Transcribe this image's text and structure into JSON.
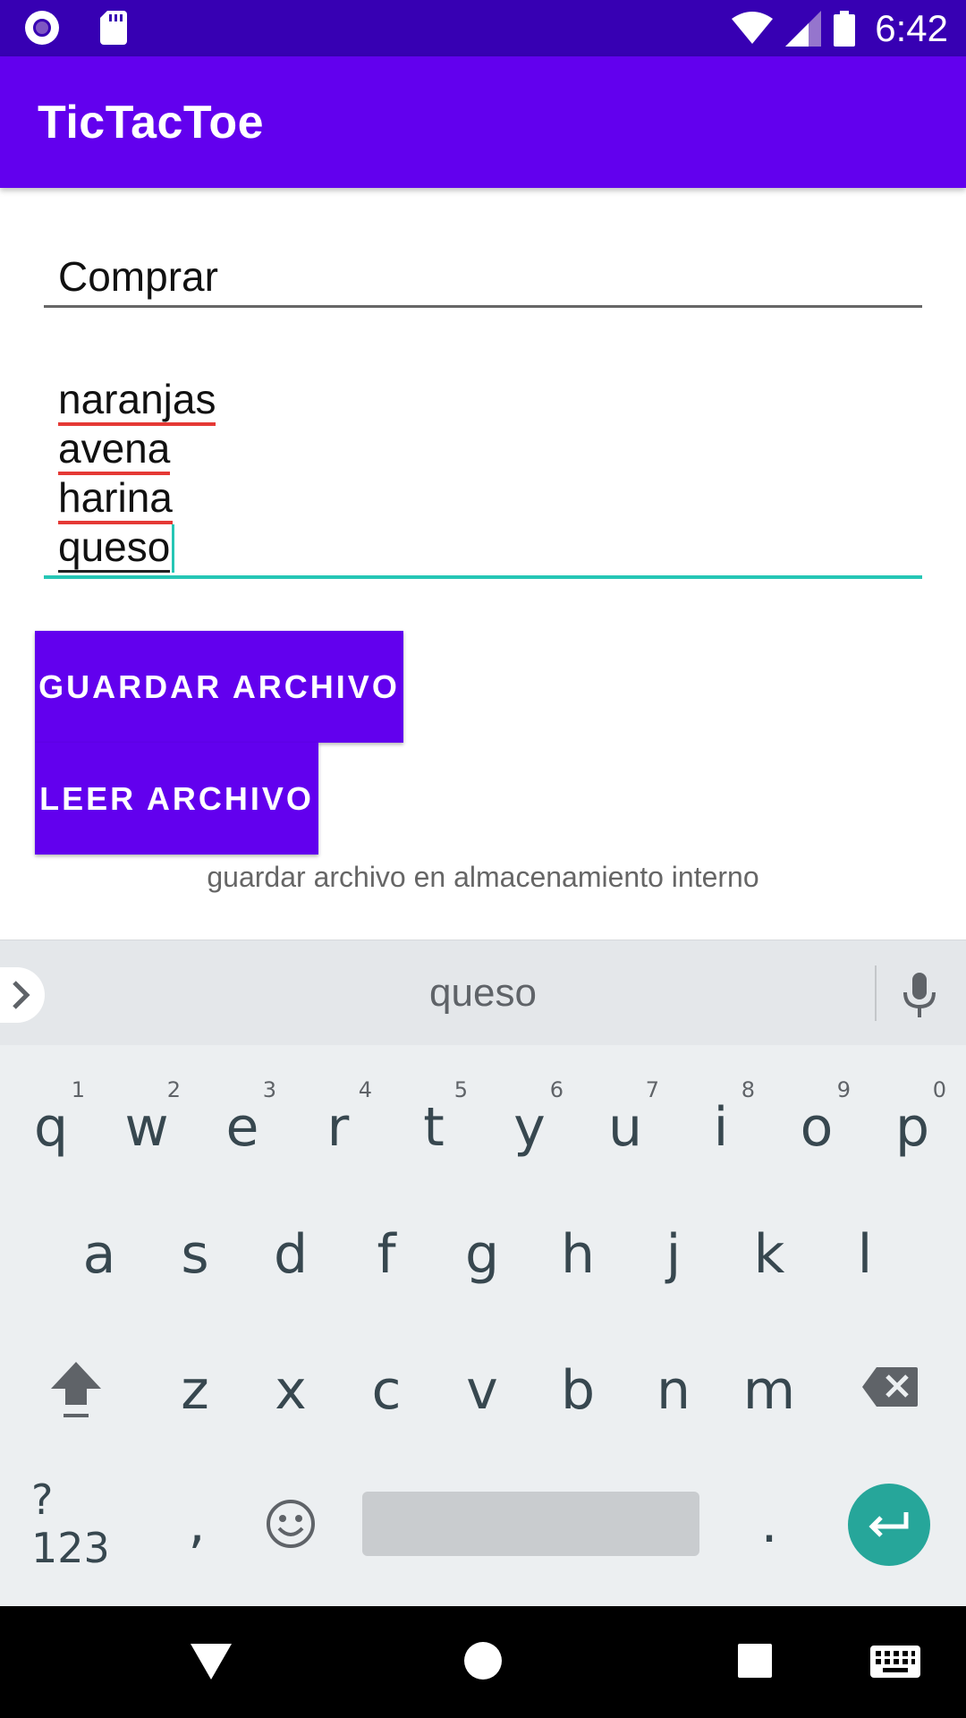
{
  "status_bar": {
    "time": "6:42"
  },
  "app_bar": {
    "title": "TicTacToe"
  },
  "form": {
    "title_value": "Comprar",
    "content_lines": [
      "naranjas",
      "avena",
      "harina",
      "queso"
    ],
    "save_button": "GUARDAR ARCHIVO",
    "read_button": "LEER ARCHIVO",
    "hint": "guardar archivo en almacenamiento interno"
  },
  "keyboard": {
    "suggestion": "queso",
    "row1": [
      {
        "k": "q",
        "n": "1"
      },
      {
        "k": "w",
        "n": "2"
      },
      {
        "k": "e",
        "n": "3"
      },
      {
        "k": "r",
        "n": "4"
      },
      {
        "k": "t",
        "n": "5"
      },
      {
        "k": "y",
        "n": "6"
      },
      {
        "k": "u",
        "n": "7"
      },
      {
        "k": "i",
        "n": "8"
      },
      {
        "k": "o",
        "n": "9"
      },
      {
        "k": "p",
        "n": "0"
      }
    ],
    "row2": [
      "a",
      "s",
      "d",
      "f",
      "g",
      "h",
      "j",
      "k",
      "l"
    ],
    "row3": [
      "z",
      "x",
      "c",
      "v",
      "b",
      "n",
      "m"
    ],
    "symbols_label": "?123",
    "comma_label": ",",
    "period_label": "."
  },
  "colors": {
    "primary": "#6200ee",
    "primary_dark": "#3700b3",
    "accent": "#26c6b5",
    "enter": "#26a69a"
  }
}
